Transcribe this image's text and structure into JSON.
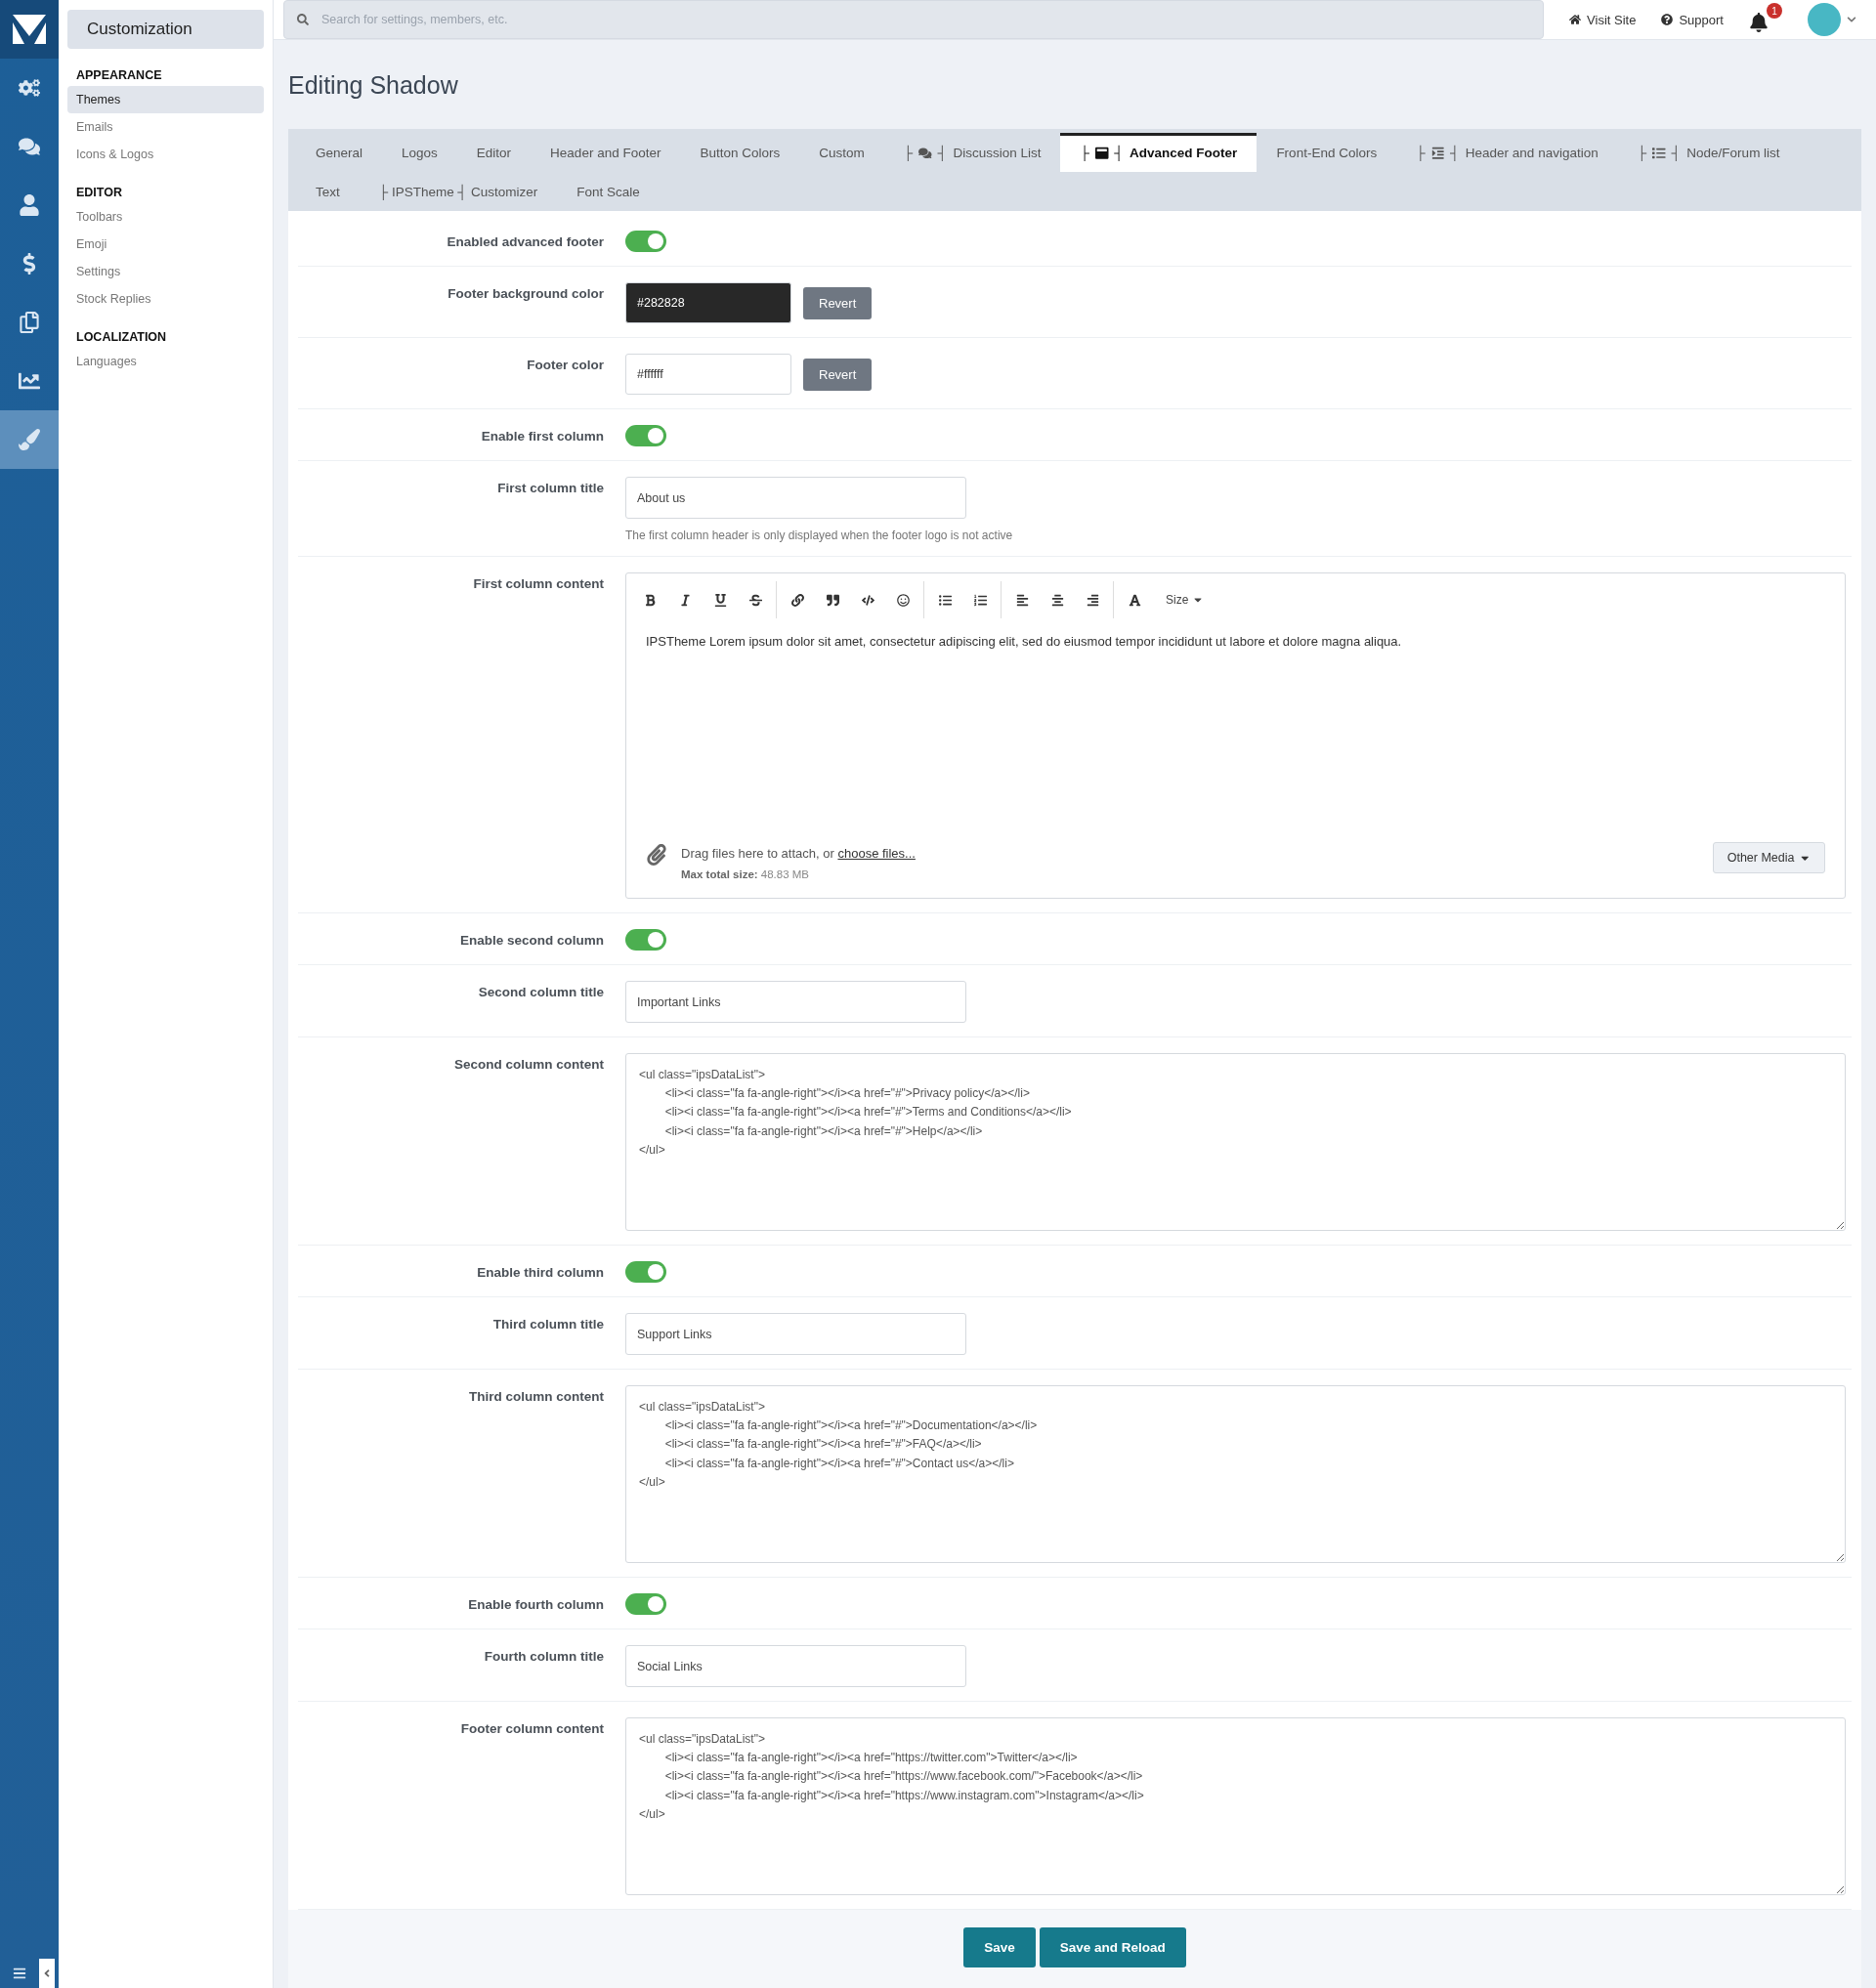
{
  "rail": {
    "items": [
      {
        "kind": "cogs",
        "selected": false
      },
      {
        "kind": "comments",
        "selected": false
      },
      {
        "kind": "user",
        "selected": false
      },
      {
        "kind": "dollar",
        "selected": false
      },
      {
        "kind": "copy",
        "selected": false
      },
      {
        "kind": "chart",
        "selected": false
      },
      {
        "kind": "brush",
        "selected": true
      }
    ]
  },
  "sidebar": {
    "title": "Customization",
    "sections": [
      {
        "heading": "APPEARANCE",
        "items": [
          {
            "label": "Themes",
            "selected": true
          },
          {
            "label": "Emails",
            "selected": false
          },
          {
            "label": "Icons & Logos",
            "selected": false
          }
        ]
      },
      {
        "heading": "EDITOR",
        "items": [
          {
            "label": "Toolbars",
            "selected": false
          },
          {
            "label": "Emoji",
            "selected": false
          },
          {
            "label": "Settings",
            "selected": false
          },
          {
            "label": "Stock Replies",
            "selected": false
          }
        ]
      },
      {
        "heading": "LOCALIZATION",
        "items": [
          {
            "label": "Languages",
            "selected": false
          }
        ]
      }
    ]
  },
  "topbar": {
    "search": {
      "placeholder": "Search for settings, members, etc."
    },
    "links": [
      {
        "kind": "home",
        "label": "Visit Site"
      },
      {
        "kind": "help",
        "label": "Support"
      }
    ],
    "notifications": {
      "count": "1"
    }
  },
  "page": {
    "title": "Editing Shadow"
  },
  "tabs": [
    {
      "label": "General",
      "selected": false
    },
    {
      "label": "Logos",
      "selected": false
    },
    {
      "label": "Editor",
      "selected": false
    },
    {
      "label": "Header and Footer",
      "selected": false
    },
    {
      "label": "Button Colors",
      "selected": false
    },
    {
      "label": "Custom",
      "selected": false
    },
    {
      "label": "Discussion List",
      "selected": false,
      "kind": "comments",
      "marks": [
        "├",
        "┤"
      ]
    },
    {
      "label": "Advanced Footer",
      "selected": true,
      "kind": "window",
      "marks": [
        "├",
        "┤"
      ]
    },
    {
      "label": "Front-End Colors",
      "selected": false
    },
    {
      "label": "Header and navigation",
      "selected": false,
      "kind": "indent",
      "marks": [
        "├",
        "┤"
      ]
    },
    {
      "label": "Node/Forum list",
      "selected": false,
      "kind": "list",
      "marks": [
        "├",
        "┤"
      ]
    },
    {
      "label": "Text",
      "selected": false
    },
    {
      "label": "├ IPSTheme ┤ Customizer",
      "selected": false
    },
    {
      "label": "Font Scale",
      "selected": false
    }
  ],
  "form": {
    "rows": [
      {
        "kind": "toggle",
        "label": "Enabled advanced footer",
        "on": true
      },
      {
        "kind": "color",
        "label": "Footer background color",
        "value": "#282828",
        "color": "#282828",
        "button": "Revert"
      },
      {
        "kind": "color",
        "label": "Footer color",
        "value": "#ffffff",
        "color": "#ffffff",
        "button": "Revert"
      },
      {
        "kind": "toggle",
        "label": "Enable first column",
        "on": true
      },
      {
        "kind": "text",
        "label": "First column title",
        "value": "About us",
        "hint": "The first column header is only displayed when the footer logo is not active"
      },
      {
        "kind": "editor",
        "label": "First column content",
        "size": "Size",
        "content": "IPSTheme Lorem ipsum dolor sit amet, consectetur adipiscing elit, sed do eiusmod tempor incididunt ut labore et dolore magna aliqua.",
        "drop_text": "Drag files here to attach, or",
        "drop_link": "choose files...",
        "limit": "**Max total size:** 48.83 MB",
        "media": "Other Media"
      },
      {
        "kind": "toggle",
        "label": "Enable second column",
        "on": true
      },
      {
        "kind": "text",
        "label": "Second column title",
        "value": "Important Links"
      },
      {
        "kind": "code",
        "label": "Second column content",
        "value": "<ul class=\"ipsDataList\">\n\t<li><i class=\"fa fa-angle-right\"></i><a href=\"#\">Privacy policy</a></li>\n\t<li><i class=\"fa fa-angle-right\"></i><a href=\"#\">Terms and Conditions</a></li>\n\t<li><i class=\"fa fa-angle-right\"></i><a href=\"#\">Help</a></li>\n</ul>"
      },
      {
        "kind": "toggle",
        "label": "Enable third column",
        "on": true
      },
      {
        "kind": "text",
        "label": "Third column title",
        "value": "Support Links"
      },
      {
        "kind": "code",
        "label": "Third column content",
        "value": "<ul class=\"ipsDataList\">\n\t<li><i class=\"fa fa-angle-right\"></i><a href=\"#\">Documentation</a></li>\n\t<li><i class=\"fa fa-angle-right\"></i><a href=\"#\">FAQ</a></li>\n\t<li><i class=\"fa fa-angle-right\"></i><a href=\"#\">Contact us</a></li>\n</ul>"
      },
      {
        "kind": "toggle",
        "label": "Enable fourth column",
        "on": true
      },
      {
        "kind": "text",
        "label": "Fourth column title",
        "value": "Social Links"
      },
      {
        "kind": "code",
        "label": "Footer column content",
        "value": "<ul class=\"ipsDataList\">\n\t<li><i class=\"fa fa-angle-right\"></i><a href=\"https://twitter.com\">Twitter</a></li>\n\t<li><i class=\"fa fa-angle-right\"></i><a href=\"https://www.facebook.com/\">Facebook</a></li>\n\t<li><i class=\"fa fa-angle-right\"></i><a href=\"https://www.instagram.com\">Instagram</a></li>\n</ul>"
      }
    ]
  },
  "buttons": [
    {
      "label": "Save"
    },
    {
      "label": "Save and Reload"
    }
  ]
}
